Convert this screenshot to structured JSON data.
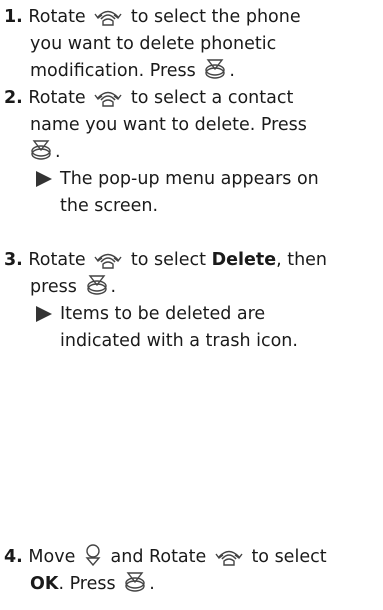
{
  "steps": [
    {
      "number": "1.",
      "lines": [
        "Rotate",
        "to select the phone",
        "you want to delete phonetic",
        "modification. Press"
      ]
    },
    {
      "number": "2.",
      "lines": [
        "Rotate",
        "to select a contact",
        "name you want to delete. Press"
      ],
      "result": [
        "The pop-up menu appears on",
        "the screen."
      ]
    },
    {
      "number": "3.",
      "lines": [
        "Rotate",
        "to select",
        "Delete",
        ", then",
        "press"
      ],
      "result": [
        "Items to be deleted are",
        "indicated with a trash icon."
      ]
    },
    {
      "number": "4.",
      "lines": [
        "Move",
        "and Rotate",
        "to select",
        "OK",
        ". Press"
      ]
    }
  ],
  "punct": "."
}
